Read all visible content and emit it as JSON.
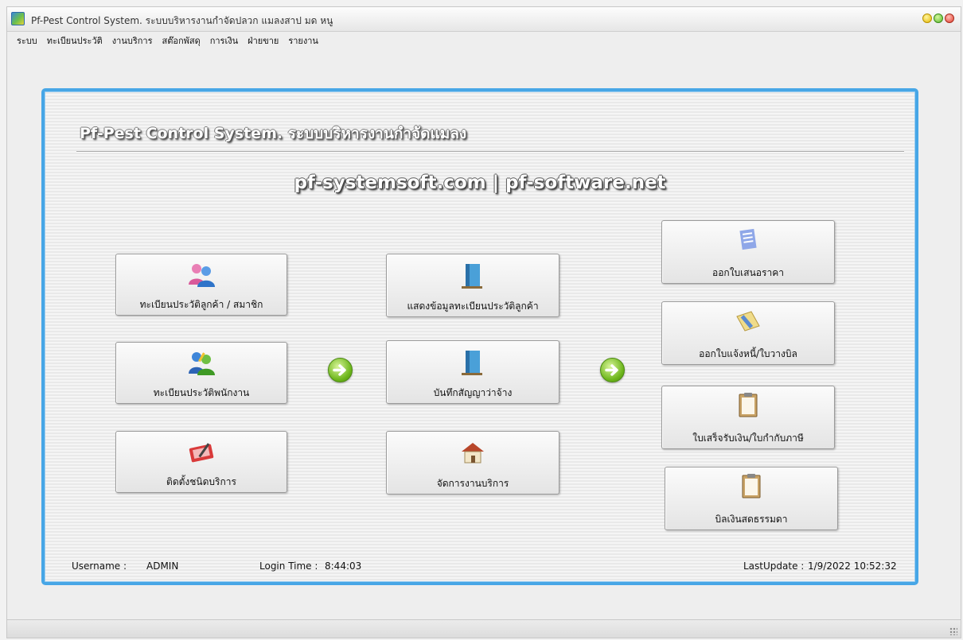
{
  "window": {
    "title": "Pf-Pest Control System. ระบบบริหารงานกำจัดปลวก แมลงสาป มด หนู"
  },
  "menu": [
    "ระบบ",
    "ทะเบียนประวัติ",
    "งานบริการ",
    "สต๊อกพัสดุ",
    "การเงิน",
    "ฝ่ายขาย",
    "รายงาน"
  ],
  "panel": {
    "heading": "Pf-Pest Control System. ระบบบริหารงานกำจัดแมลง",
    "website": "pf-systemsoft.com | pf-software.net"
  },
  "buttons": {
    "customer_register": "ทะเบียนประวัติลูกค้า / สมาชิก",
    "employee_register": "ทะเบียนประวัติพนักงาน",
    "service_types": "ติดตั้งชนิดบริการ",
    "show_customer": "แสดงข้อมูลทะเบียนประวัติลูกค้า",
    "contract": "บันทึกสัญญาว่าจ้าง",
    "manage_service": "จัดการงานบริการ",
    "quotation": "ออกใบเสนอราคา",
    "invoice": "ออกใบแจ้งหนี้/ใบวางบิล",
    "receipt": "ใบเสร็จรับเงิน/ใบกำกับภาษี",
    "cash_bill": "บิลเงินสดธรรมดา"
  },
  "footer": {
    "username_label": "Username :",
    "username_value": "ADMIN",
    "login_label": "Login Time :",
    "login_value": "8:44:03",
    "lastupdate_label": "LastUpdate :",
    "lastupdate_value": "1/9/2022 10:52:32"
  },
  "colors": {
    "panel_border": "#47a6e6",
    "arrow_green": "#6cb51a"
  },
  "icons": {
    "customer_register": "users-pair-icon",
    "employee_register": "employees-icon",
    "service_types": "tablet-pen-icon",
    "show_customer": "book-icon",
    "contract": "book-icon",
    "manage_service": "house-icon",
    "quotation": "notepad-icon",
    "invoice": "pencil-icon",
    "receipt": "clipboard-icon",
    "cash_bill": "clipboard-icon",
    "flow_arrow": "arrow-right-circle-icon"
  }
}
